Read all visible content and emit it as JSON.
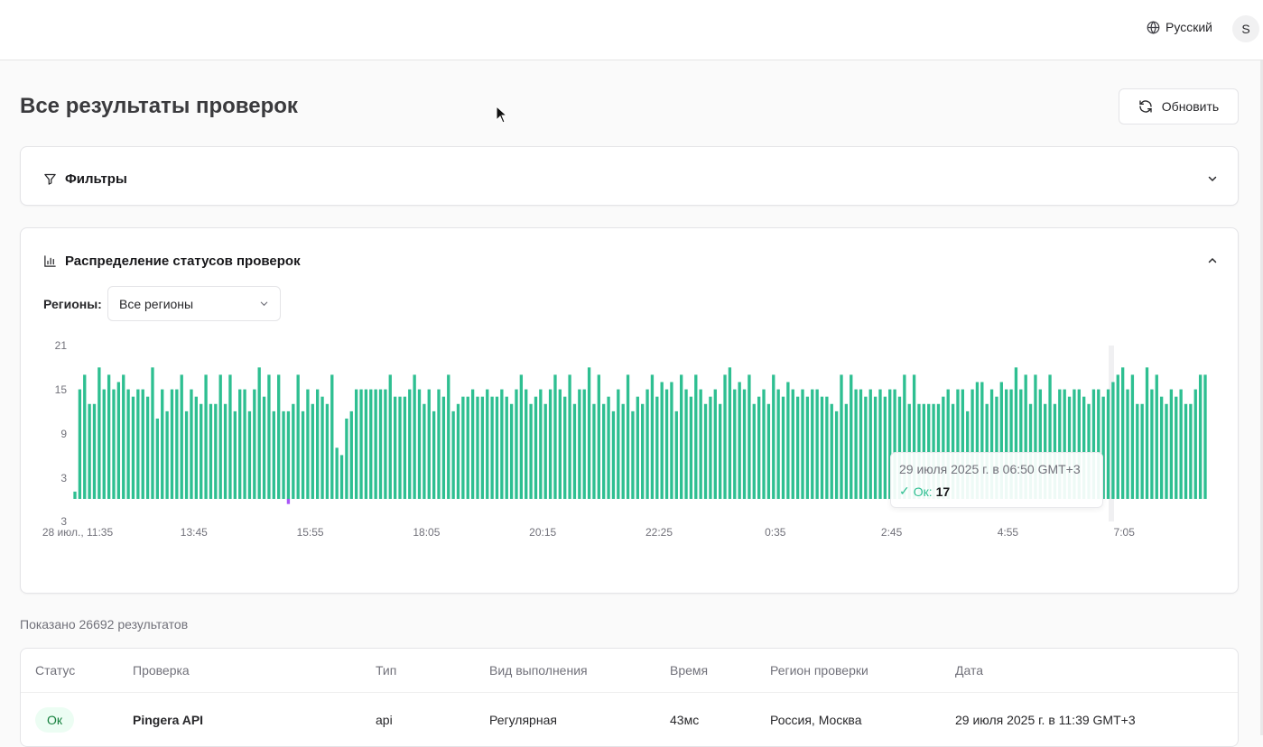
{
  "topbar": {
    "language": "Русский",
    "avatar_initial": "S"
  },
  "page": {
    "title": "Все результаты проверок",
    "refresh_label": "Обновить"
  },
  "filters": {
    "title": "Фильтры"
  },
  "distribution": {
    "title": "Распределение статусов проверок",
    "regions_label": "Регионы:",
    "regions_value": "Все регионы"
  },
  "tooltip": {
    "date": "29 июля 2025 г. в 06:50 GMT+3",
    "status_label": "Ок:",
    "count": "17"
  },
  "chart_data": {
    "type": "bar",
    "title": "",
    "y_ticks": [
      "21",
      "15",
      "9",
      "3",
      "3"
    ],
    "x_tick_labels": [
      "28 июл., 11:35",
      "13:45",
      "15:55",
      "18:05",
      "20:15",
      "22:25",
      "0:35",
      "2:45",
      "4:55",
      "7:05"
    ],
    "ylim": [
      0,
      21
    ],
    "grid": false,
    "series": [
      {
        "status": "ok",
        "color": "#2ebf91",
        "values": [
          1,
          15,
          17,
          13,
          13,
          18,
          15,
          17,
          15,
          16,
          17,
          15,
          14,
          15,
          15,
          14,
          18,
          11,
          15,
          12,
          15,
          15,
          17,
          12,
          15,
          14,
          13,
          17,
          13,
          13,
          17,
          13,
          17,
          12,
          15,
          15,
          12,
          15,
          18,
          14,
          17,
          12,
          17,
          12,
          12,
          13,
          17,
          12,
          15,
          13,
          15,
          14,
          13,
          17,
          7,
          6,
          11,
          12,
          15,
          15,
          15,
          15,
          15,
          15,
          15,
          17,
          14,
          14,
          14,
          15,
          17,
          15,
          13,
          15,
          12,
          15,
          14,
          17,
          12,
          13,
          14,
          14,
          15,
          14,
          14,
          15,
          14,
          14,
          15,
          14,
          13,
          15,
          17,
          15,
          13,
          14,
          15,
          13,
          15,
          17,
          15,
          14,
          17,
          13,
          15,
          15,
          18,
          13,
          17,
          13,
          14,
          12,
          15,
          13,
          17,
          12,
          14,
          13,
          15,
          17,
          14,
          16,
          15,
          16,
          12,
          17,
          15,
          14,
          17,
          15,
          13,
          14,
          15,
          13,
          17,
          18,
          15,
          16,
          15,
          17,
          13,
          14,
          15,
          13,
          17,
          15,
          14,
          16,
          15,
          14,
          15,
          14,
          15,
          15,
          14,
          14,
          13,
          12,
          17,
          13,
          17,
          15,
          15,
          14,
          15,
          14,
          15,
          14,
          15,
          15,
          14,
          17,
          13,
          17,
          13,
          13,
          13,
          13,
          13,
          14,
          15,
          13,
          15,
          15,
          12,
          15,
          16,
          16,
          13,
          15,
          14,
          16,
          15,
          15,
          18,
          15,
          17,
          13,
          17,
          15,
          13,
          17,
          13,
          15,
          15,
          14,
          15,
          15,
          14,
          13,
          15,
          15,
          14,
          15,
          16,
          17,
          18,
          15,
          17,
          13,
          13,
          18,
          15,
          17,
          14,
          13,
          15,
          14,
          15,
          13,
          13,
          15,
          17,
          17
        ]
      },
      {
        "status": "error",
        "color": "#a855f7",
        "index": 44,
        "values": [
          1
        ]
      }
    ]
  }
}
